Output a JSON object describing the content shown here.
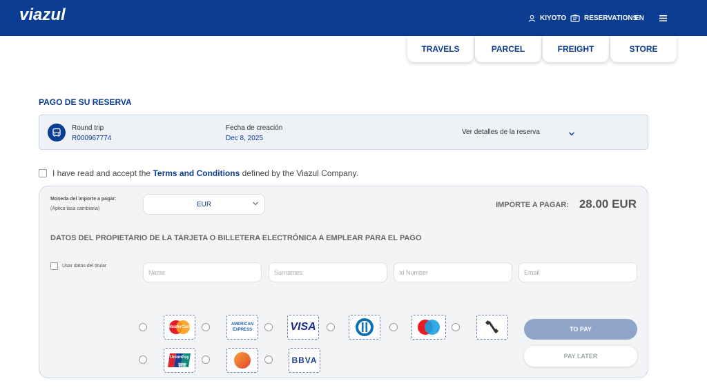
{
  "header": {
    "logo": "viazul",
    "location": "KIYOTO",
    "reservations": "RESERVATIONS",
    "language": "EN",
    "brand_color": "#0a3d91"
  },
  "nav": {
    "tabs": [
      {
        "label": "TRAVELS"
      },
      {
        "label": "PARCEL"
      },
      {
        "label": "FREIGHT"
      },
      {
        "label": "STORE"
      }
    ]
  },
  "page": {
    "title": "PAGO DE SU RESERVA"
  },
  "summary": {
    "trip_type": "Round trip",
    "reservation_id": "R000967774",
    "creation_label": "Fecha de creación",
    "creation_date": "Dec 8, 2025",
    "details_label": "Ver detalles de la reserva"
  },
  "terms": {
    "prefix": "I have read and accept the",
    "link": "Terms and Conditions",
    "suffix": "defined by the Viazul Company."
  },
  "payment": {
    "currency_label": "Moneda del importe a pagar:",
    "currency_note": "(Aplica tasa cambiaria)",
    "currency_value": "EUR",
    "amount_label": "IMPORTE A PAGAR:",
    "amount_value": "28.00 EUR",
    "owner_title": "DATOS DEL PROPIETARIO DE LA TARJETA O BILLETERA ELECTRÓNICA A EMPLEAR PARA EL PAGO",
    "use_holder_label": "Usar datos del titular",
    "fields": {
      "name_placeholder": "Name",
      "surnames_placeholder": "Surnames",
      "id_placeholder": "Id Number",
      "email_placeholder": "Email"
    },
    "methods": {
      "mastercard": "MasterCard",
      "amex_line1": "AMERICAN",
      "amex_line2": "EXPRESS",
      "visa": "VISA",
      "unionpay": "UnionPay",
      "unionpay_cn": "银联",
      "bbva": "BBVA"
    },
    "pay_button": "TO PAY",
    "pay_later_button": "PAY LATER"
  }
}
